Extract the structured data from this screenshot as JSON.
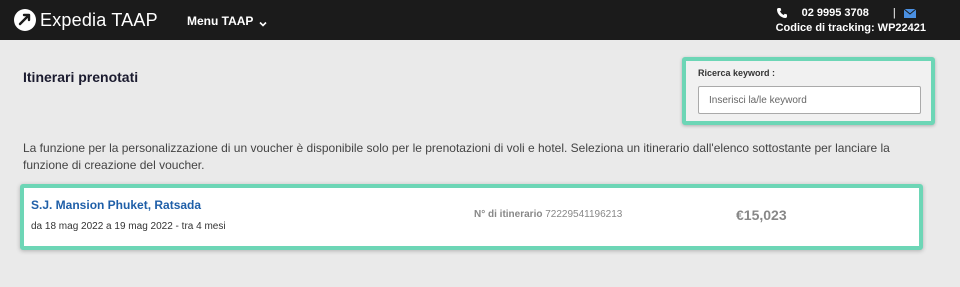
{
  "header": {
    "brand": "Expedia TAAP",
    "menu_label": "Menu TAAP",
    "phone": "02 9995 3708",
    "separator": "|",
    "tracking": "Codice di tracking: WP22421"
  },
  "page": {
    "title": "Itinerari prenotati"
  },
  "search": {
    "label": "Ricerca keyword :",
    "placeholder": "Inserisci la/le keyword",
    "value": ""
  },
  "info": {
    "text": "La funzione per la personalizzazione di un voucher è disponibile solo per le prenotazioni di voli e hotel. Seleziona un itinerario dall'elenco sottostante per lanciare la funzione di creazione del voucher."
  },
  "itineraries": [
    {
      "name": "S.J. Mansion Phuket, Ratsada",
      "dates": "da 18 mag 2022 a 19 mag 2022 - tra 4 mesi",
      "number_label": "N° di itinerario",
      "number": "72229541196213",
      "price": "€15,023"
    }
  ],
  "colors": {
    "topbar": "#1b1b1b",
    "highlight": "#6dd6b6",
    "link": "#1f5fa8",
    "background": "#eaeaea"
  },
  "icons": [
    "expedia-logo-icon",
    "chevron-down-icon",
    "phone-icon",
    "mail-icon"
  ]
}
